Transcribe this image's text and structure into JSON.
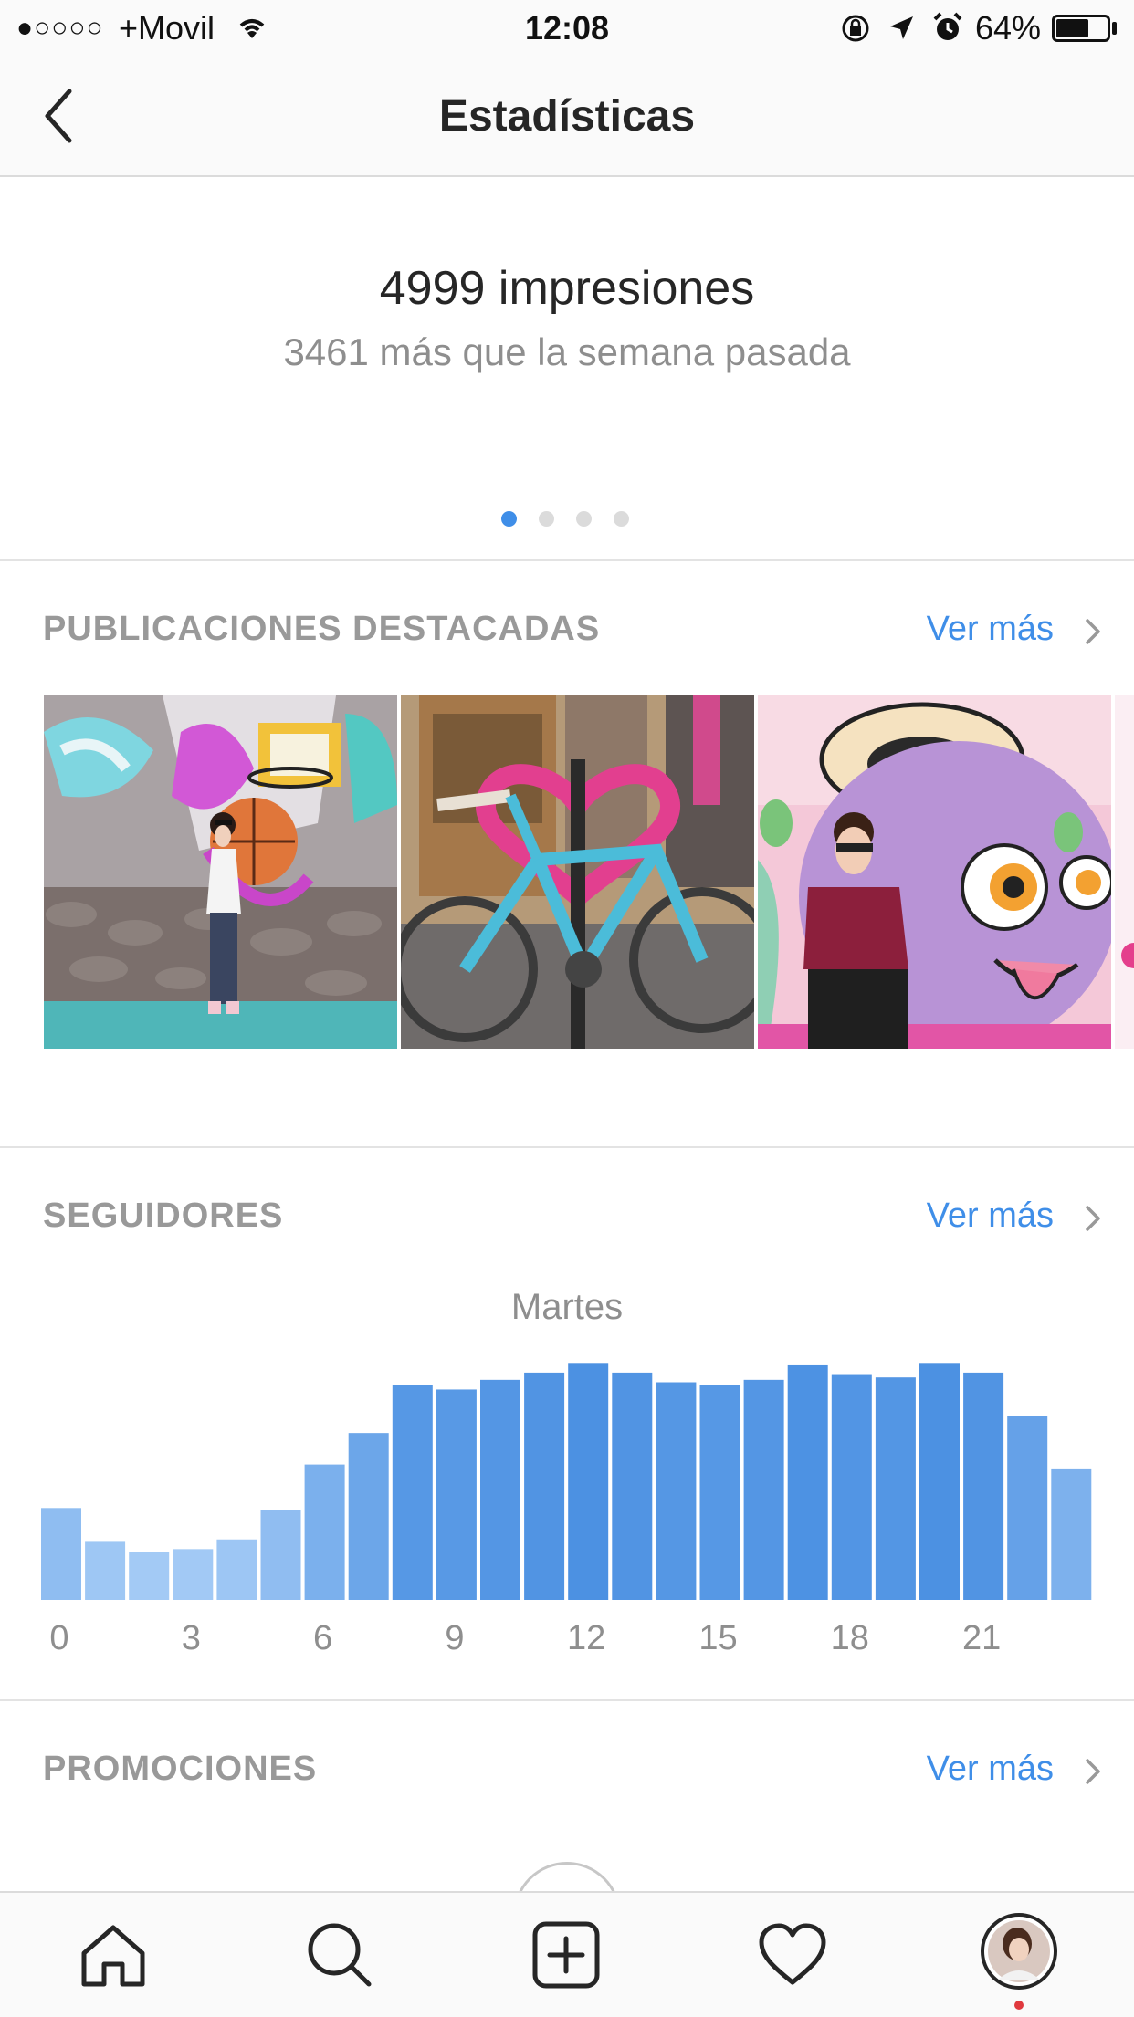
{
  "status_bar": {
    "signal": "●○○○○",
    "carrier": "+Movil",
    "time": "12:08",
    "battery_pct": "64%",
    "battery_level": 0.64
  },
  "nav": {
    "title": "Estadísticas",
    "back_icon": "chevron-left-icon"
  },
  "summary": {
    "impressions": "4999 impresiones",
    "delta": "3461 más que la semana pasada",
    "page_count": 4,
    "active_page": 0
  },
  "sections": {
    "top_posts": {
      "title": "PUBLICACIONES DESTACADAS",
      "more": "Ver más"
    },
    "followers": {
      "title": "SEGUIDORES",
      "more": "Ver más",
      "day": "Martes"
    },
    "promotions": {
      "title": "PROMOCIONES",
      "more": "Ver más"
    }
  },
  "posts": [
    {
      "name": "post-graffiti-basketball"
    },
    {
      "name": "post-bicycle-heart"
    },
    {
      "name": "post-purple-monster-mural"
    }
  ],
  "chart_data": {
    "type": "bar",
    "x": [
      0,
      1,
      2,
      3,
      4,
      5,
      6,
      7,
      8,
      9,
      10,
      11,
      12,
      13,
      14,
      15,
      16,
      17,
      18,
      19,
      20,
      21,
      22,
      23
    ],
    "values": [
      38,
      24,
      20,
      21,
      25,
      37,
      56,
      69,
      89,
      87,
      91,
      94,
      98,
      94,
      90,
      89,
      91,
      97,
      93,
      92,
      98,
      94,
      76,
      54
    ],
    "tick_labels": [
      "0",
      "3",
      "6",
      "9",
      "12",
      "15",
      "18",
      "21"
    ],
    "tick_positions": [
      0,
      3,
      6,
      9,
      12,
      15,
      18,
      21
    ],
    "ylim": [
      0,
      100
    ],
    "color_low": "#b9d8fa",
    "color_high": "#4a90e2",
    "grid": false
  },
  "tabbar": {
    "items": [
      "home-icon",
      "search-icon",
      "add-post-icon",
      "activity-heart-icon",
      "profile-avatar"
    ]
  },
  "colors": {
    "accent": "#3f8ee8",
    "muted": "#999999",
    "notification_dot": "#e0393e"
  }
}
